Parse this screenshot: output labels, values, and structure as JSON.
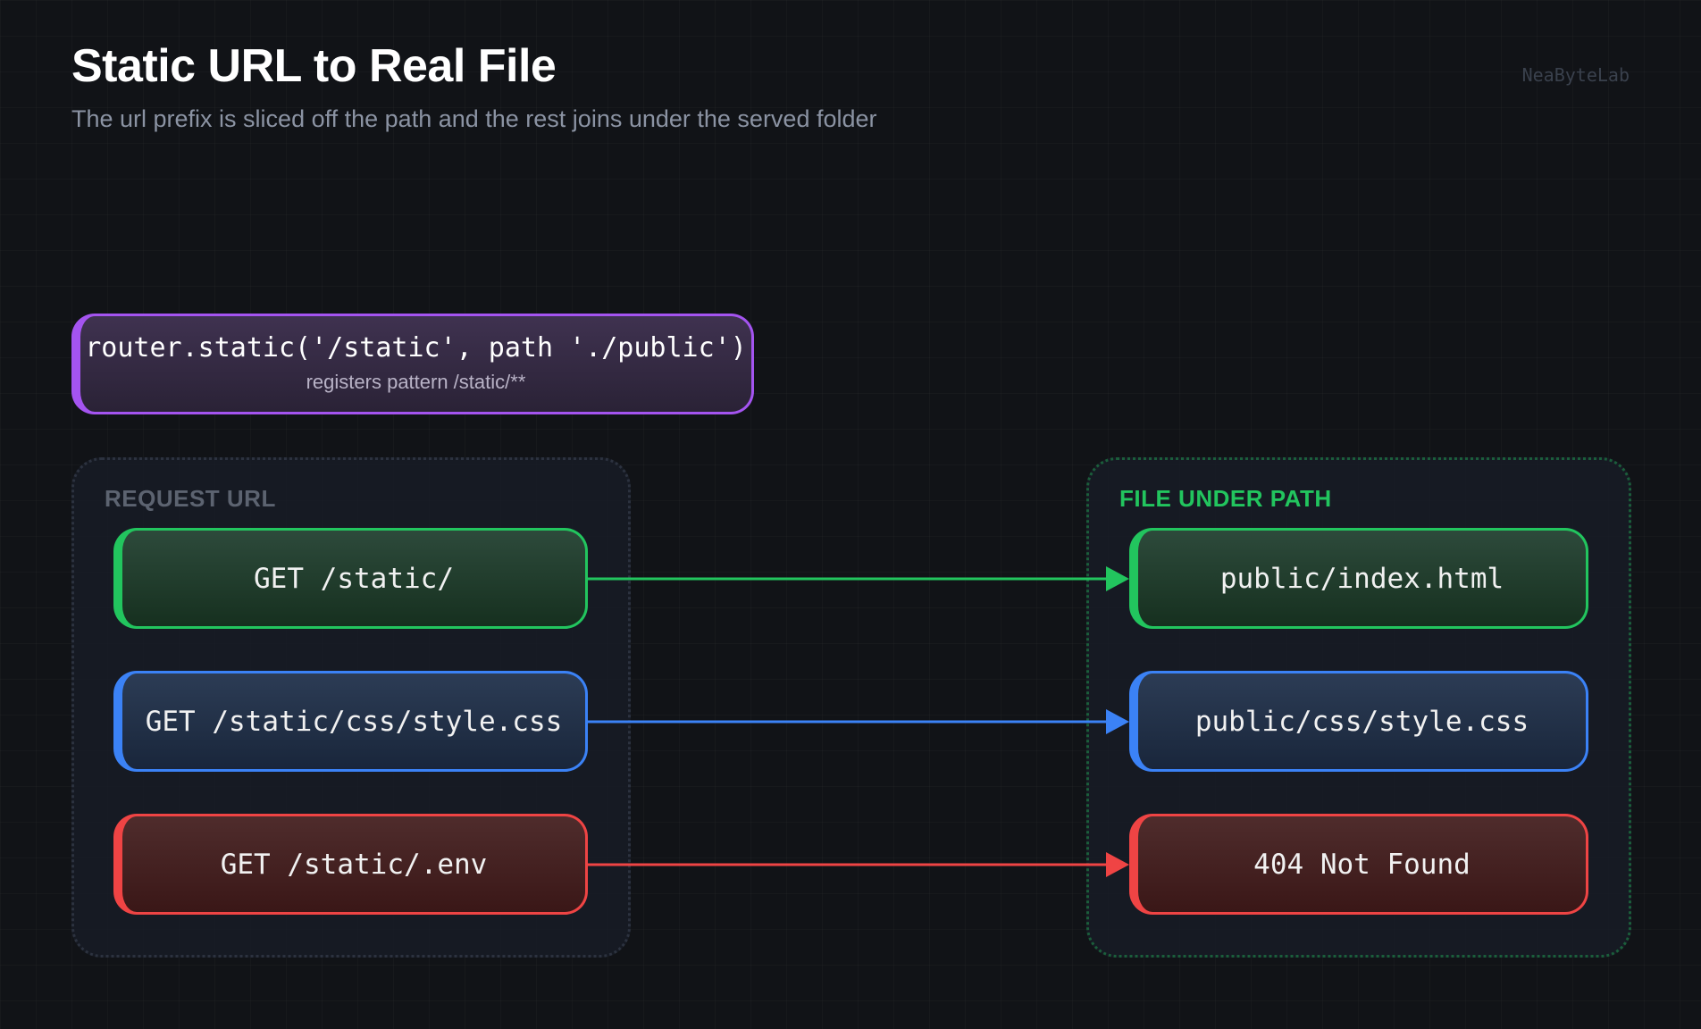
{
  "title": "Static URL to Real File",
  "subtitle": "The url prefix is sliced off the path and the rest joins under the served folder",
  "watermark": "NeaByteLab",
  "router": {
    "code": "router.static('/static', path './public')",
    "note": "registers pattern /static/**"
  },
  "request_group": {
    "label": "REQUEST URL",
    "items": [
      "GET /static/",
      "GET /static/css/style.css",
      "GET /static/.env"
    ]
  },
  "file_group": {
    "label": "FILE UNDER PATH",
    "items": [
      "public/index.html",
      "public/css/style.css",
      "404 Not Found"
    ]
  },
  "colors": {
    "green": "#22c55e",
    "blue": "#3b82f6",
    "red": "#ef4444",
    "purple": "#a454f0"
  }
}
